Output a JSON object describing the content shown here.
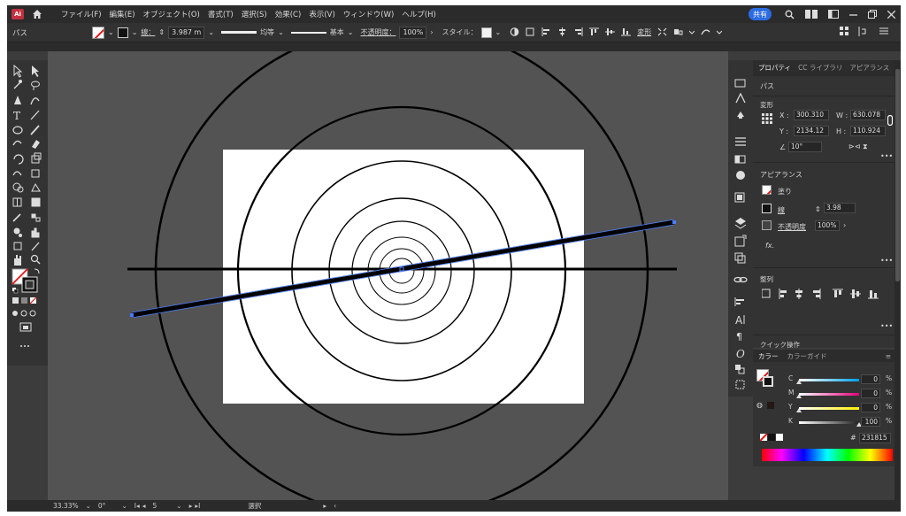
{
  "app": {
    "logo": "Ai",
    "share_label": "共有"
  },
  "menu": [
    "ファイル(F)",
    "編集(E)",
    "オブジェクト(O)",
    "書式(T)",
    "選択(S)",
    "効果(C)",
    "表示(V)",
    "ウィンドウ(W)",
    "ヘルプ(H)"
  ],
  "controlbar": {
    "selection_label": "パス",
    "stroke_label": "線：",
    "stroke_value": "3.987 m",
    "profile_label": "均等",
    "brush_label": "基本",
    "opacity_label": "不透明度：",
    "opacity_value": "100%",
    "style_label": "スタイル：",
    "transform_label": "変形"
  },
  "properties": {
    "tabs": [
      "プロパティ",
      "CC ライブラリ",
      "アピアランス"
    ],
    "selection": "パス",
    "transform_title": "変形",
    "x_label": "X :",
    "x_value": "300.310",
    "y_label": "Y :",
    "y_value": "2134.12",
    "w_label": "W :",
    "w_value": "630.078",
    "h_label": "H :",
    "h_value": "110.924",
    "angle_value": "10°",
    "appearance_title": "アピアランス",
    "fill_label": "塗り",
    "stroke_label": "線",
    "stroke_value": "3.98",
    "opacity_label": "不透明度",
    "opacity_value": "100%",
    "fx_label": "fx.",
    "align_title": "整列",
    "quick_actions_title": "クイック操作"
  },
  "color_panel": {
    "tabs": [
      "カラー",
      "カラーガイド"
    ],
    "channels": [
      {
        "label": "C",
        "value": "0",
        "fraction": 0.0
      },
      {
        "label": "M",
        "value": "0",
        "fraction": 0.0
      },
      {
        "label": "Y",
        "value": "0",
        "fraction": 0.0
      },
      {
        "label": "K",
        "value": "100",
        "fraction": 1.0
      }
    ],
    "percent": "%",
    "hex_value": "231815"
  },
  "status": {
    "zoom": "33.33%",
    "rotate": "0°",
    "artboard": "5",
    "mode": "選択"
  },
  "colors": {
    "canvas": "#535353",
    "artboard": "#ffffff",
    "stroke": "#000000",
    "selection": "#4a7bff",
    "share": "#2c6ce3"
  }
}
